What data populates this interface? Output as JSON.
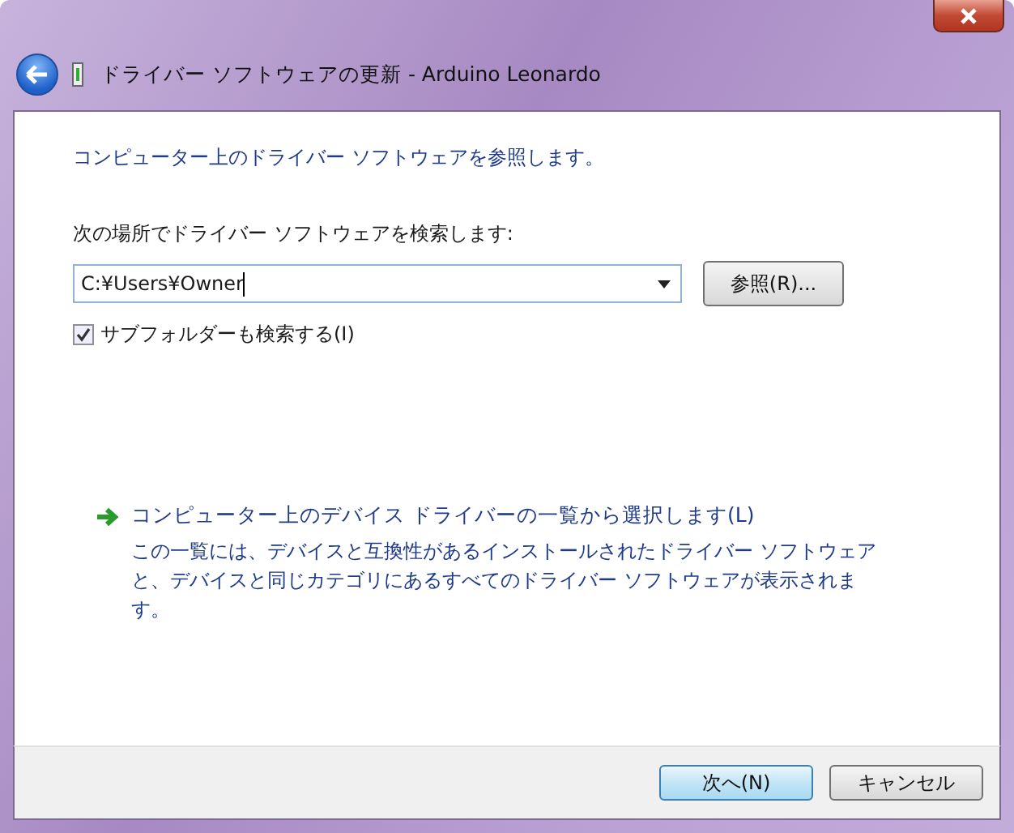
{
  "window": {
    "title": "ドライバー ソフトウェアの更新 - Arduino Leonardo"
  },
  "heading": "コンピューター上のドライバー ソフトウェアを参照します。",
  "search_location": {
    "label": "次の場所でドライバー ソフトウェアを検索します:",
    "value": "C:¥Users¥Owner",
    "browse_button": "参照(R)..."
  },
  "include_subfolders": {
    "label": "サブフォルダーも検索する(I)",
    "checked": true
  },
  "pick_from_list": {
    "link": "コンピューター上のデバイス ドライバーの一覧から選択します(L)",
    "description": "この一覧には、デバイスと互換性があるインストールされたドライバー ソフトウェアと、デバイスと同じカテゴリにあるすべてのドライバー ソフトウェアが表示されます。"
  },
  "buttons": [
    {
      "label": "次へ(N)",
      "kind": "default"
    },
    {
      "label": "キャンセル",
      "kind": "normal"
    }
  ]
}
